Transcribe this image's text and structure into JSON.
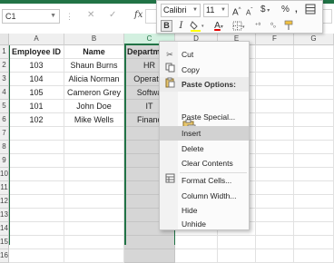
{
  "formula_bar": {
    "namebox": "C1",
    "fx": "fx",
    "cancel": "✕",
    "enter": "✓"
  },
  "columns": [
    "A",
    "B",
    "C",
    "D",
    "E",
    "F",
    "G"
  ],
  "rows": [
    "1",
    "2",
    "3",
    "4",
    "5",
    "6",
    "7",
    "8",
    "9",
    "10",
    "11",
    "12",
    "13",
    "14",
    "15",
    "16"
  ],
  "table": {
    "headers": [
      "Employee ID",
      "Name",
      "Departm"
    ],
    "data": [
      [
        "103",
        "Shaun Burns",
        "HR"
      ],
      [
        "104",
        "Alicia Norman",
        "Operatio"
      ],
      [
        "105",
        "Cameron Grey",
        "Softwa"
      ],
      [
        "101",
        "John Doe",
        "IT"
      ],
      [
        "102",
        "Mike Wells",
        "Financ"
      ]
    ]
  },
  "mini_toolbar": {
    "font": "Calibri",
    "size": "11",
    "grow": "A",
    "shrink": "A",
    "currency": "$",
    "percent": "%",
    "comma": ",",
    "bold": "B",
    "italic": "I",
    "font_color": "A"
  },
  "context_menu": {
    "items": [
      {
        "label": "Cut",
        "icon": "scissors-icon"
      },
      {
        "label": "Copy",
        "icon": "copy-icon"
      },
      {
        "label": "Paste Options:",
        "icon": "paste-icon"
      },
      {
        "label": "Paste Special...",
        "icon": ""
      },
      {
        "label": "Insert",
        "icon": ""
      },
      {
        "label": "Delete",
        "icon": ""
      },
      {
        "label": "Clear Contents",
        "icon": ""
      },
      {
        "label": "Format Cells...",
        "icon": "format-cells-icon"
      },
      {
        "label": "Column Width...",
        "icon": ""
      },
      {
        "label": "Hide",
        "icon": ""
      },
      {
        "label": "Unhide",
        "icon": ""
      }
    ],
    "highlighted": "Insert"
  },
  "colors": {
    "excel_green": "#217346",
    "selection_gray": "#d6d6d6",
    "highlight": "#d2d2d2"
  }
}
